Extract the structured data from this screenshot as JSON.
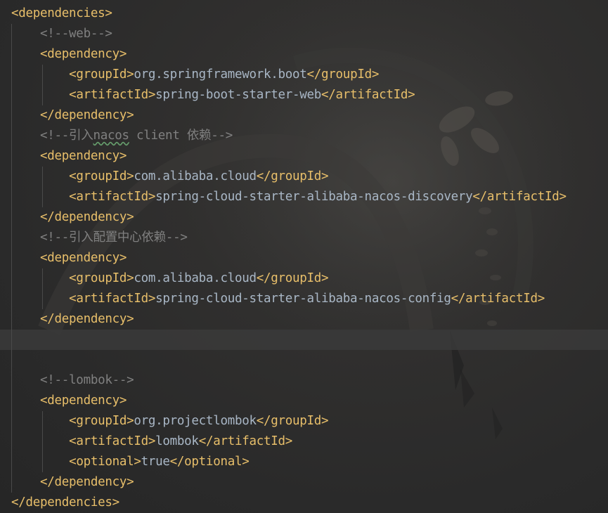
{
  "colors": {
    "tag": "#e8bf6a",
    "text": "#a9b7c6",
    "comment": "#808080",
    "background": "#2b2b2b",
    "current_line": "#3a3a3a",
    "typo_underline": "#659c6b"
  },
  "lines": [
    {
      "kind": "open",
      "tag": "dependencies"
    },
    {
      "kind": "comment",
      "text": "<!--web-->"
    },
    {
      "kind": "open",
      "tag": "dependency"
    },
    {
      "kind": "element",
      "tag": "groupId",
      "value": "org.springframework.boot"
    },
    {
      "kind": "element",
      "tag": "artifactId",
      "value": "spring-boot-starter-web"
    },
    {
      "kind": "close",
      "tag": "dependency"
    },
    {
      "kind": "comment",
      "pre": "<!--引入",
      "typo": "nacos",
      "post": " client 依赖-->"
    },
    {
      "kind": "open",
      "tag": "dependency"
    },
    {
      "kind": "element",
      "tag": "groupId",
      "value": "com.alibaba.cloud"
    },
    {
      "kind": "element",
      "tag": "artifactId",
      "value": "spring-cloud-starter-alibaba-nacos-discovery"
    },
    {
      "kind": "close",
      "tag": "dependency"
    },
    {
      "kind": "comment",
      "text": "<!--引入配置中心依赖-->"
    },
    {
      "kind": "open",
      "tag": "dependency"
    },
    {
      "kind": "element",
      "tag": "groupId",
      "value": "com.alibaba.cloud"
    },
    {
      "kind": "element",
      "tag": "artifactId",
      "value": "spring-cloud-starter-alibaba-nacos-config"
    },
    {
      "kind": "close",
      "tag": "dependency"
    },
    {
      "kind": "blank"
    },
    {
      "kind": "blank"
    },
    {
      "kind": "comment",
      "text": "<!--lombok-->"
    },
    {
      "kind": "open",
      "tag": "dependency"
    },
    {
      "kind": "element",
      "tag": "groupId",
      "value": "org.projectlombok"
    },
    {
      "kind": "element",
      "tag": "artifactId",
      "value": "lombok"
    },
    {
      "kind": "element",
      "tag": "optional",
      "value": "true"
    },
    {
      "kind": "close",
      "tag": "dependency"
    },
    {
      "kind": "close",
      "tag": "dependencies"
    }
  ]
}
